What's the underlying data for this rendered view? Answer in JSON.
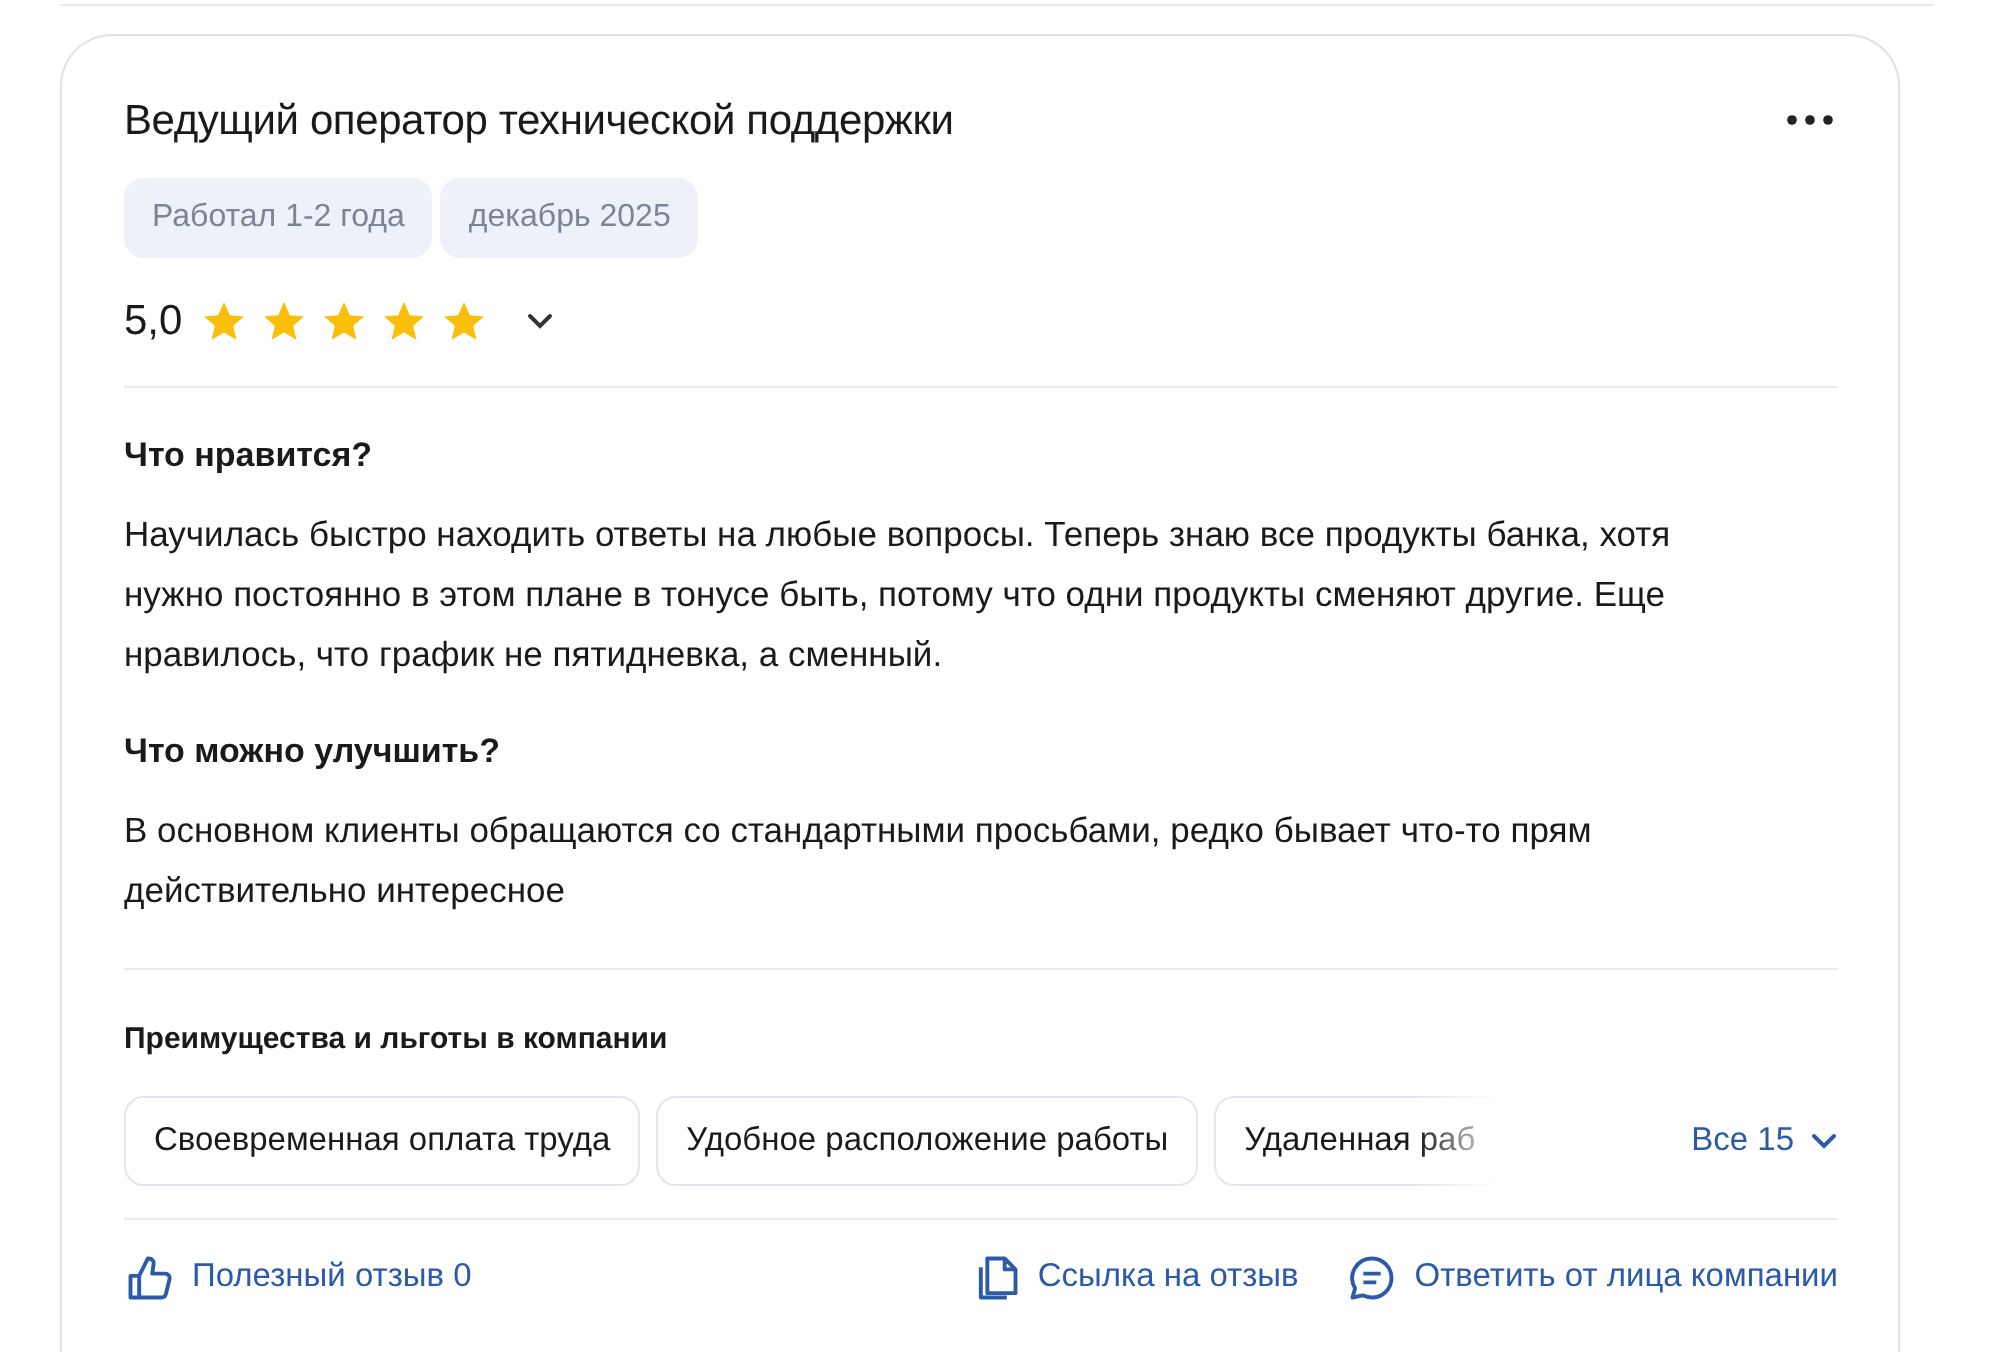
{
  "review": {
    "title": "Ведущий оператор технической поддержки",
    "tags": [
      "Работал 1-2 года",
      "декабрь 2025"
    ],
    "rating": {
      "value": "5,0",
      "stars": 5,
      "expanded": false
    },
    "sections": [
      {
        "heading": "Что нравится?",
        "text": "Научилась быстро находить ответы на любые вопросы. Теперь знаю все продукты банка, хотя нужно постоянно в этом плане в тонусе быть, потому что одни продукты сменяют другие. Еще нравилось, что график не пятидневка, а сменный."
      },
      {
        "heading": "Что можно улучшить?",
        "text": "В основном клиенты обращаются со стандартными просьбами, редко бывает что-то прям действительно интересное"
      }
    ],
    "benefits": {
      "heading": "Преимущества и льготы в компании",
      "items": [
        "Своевременная оплата труда",
        "Удобное расположение работы",
        "Удаленная раб"
      ],
      "more": "Все 15"
    },
    "actions": [
      {
        "kind": "like",
        "label": "Полезный отзыв 0"
      },
      {
        "kind": "link",
        "label": "Ссылка на отзыв"
      },
      {
        "kind": "reply",
        "label": "Ответить от лица компании"
      }
    ]
  }
}
